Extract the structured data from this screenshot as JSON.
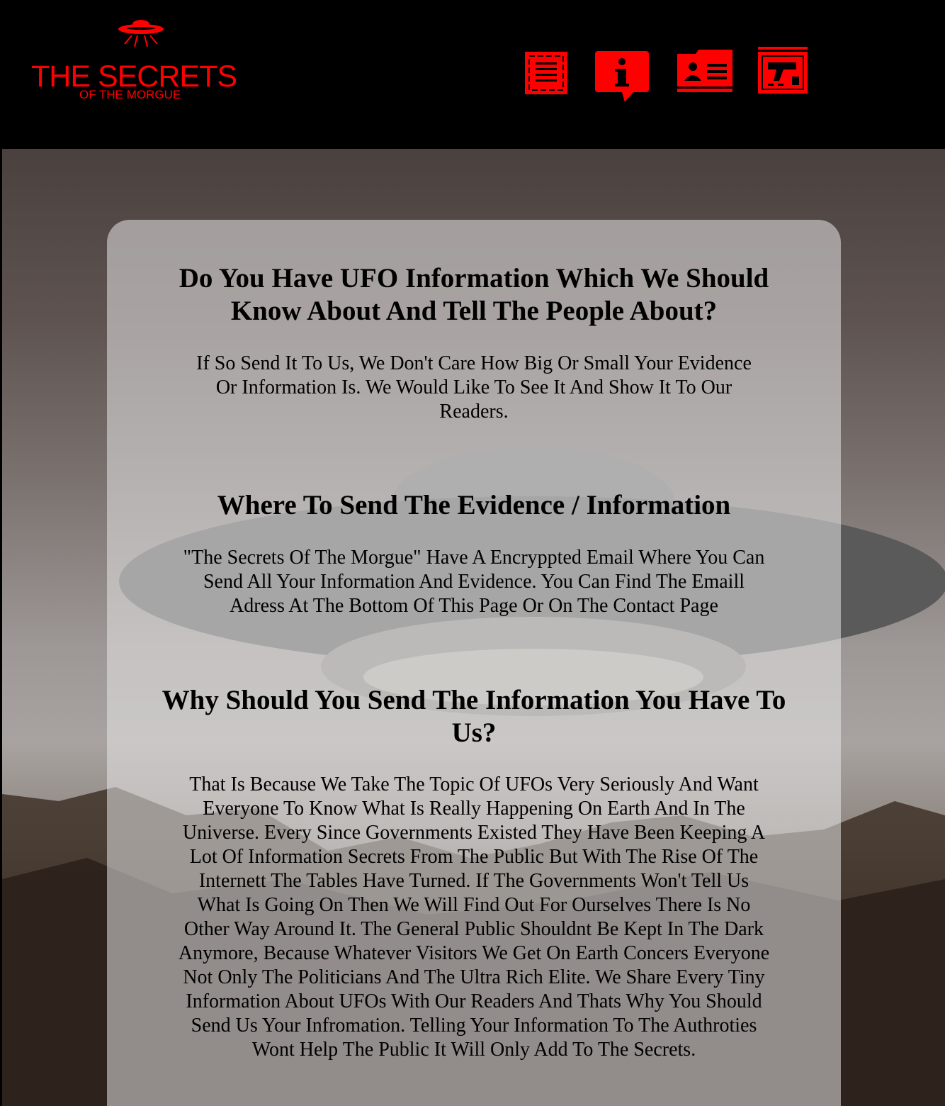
{
  "brand": {
    "title": "THE SECRETS",
    "subtitle": "OF THE MORGUE",
    "color": "#ff0000"
  },
  "nav": [
    {
      "icon": "document-list-icon",
      "label": "Articles"
    },
    {
      "icon": "info-bubble-icon",
      "label": "About"
    },
    {
      "icon": "contact-card-icon",
      "label": "Contact"
    },
    {
      "icon": "evidence-case-icon",
      "label": "Evidence"
    }
  ],
  "content": {
    "section1": {
      "heading": "Do You Have UFO Information Which We Should Know About And Tell The People About?",
      "text": "If So Send It To Us, We Don't Care How Big Or Small Your Evidence Or Information Is. We Would Like To See It And Show It To Our Readers."
    },
    "section2": {
      "heading": "Where To Send The Evidence / Information",
      "text": "\"The Secrets Of The Morgue\" Have A Encryppted Email Where You Can Send All Your Information And Evidence. You Can Find The Emaill Adress At The Bottom Of This Page Or On The Contact Page"
    },
    "section3": {
      "heading": "Why Should You Send The Information You Have To Us?",
      "text": "That Is Because We Take The Topic Of UFOs Very Seriously And Want Everyone To Know What Is Really Happening On Earth And In The Universe. Every Since Governments Existed They Have Been Keeping A Lot Of Information Secrets From The Public But With The Rise Of The Internett The Tables Have Turned. If The Governments Won't Tell Us What Is Going On Then We Will Find Out For Ourselves There Is No Other Way Around It. The General Public Shouldnt Be Kept In The Dark Anymore, Because Whatever Visitors We Get On Earth Concers Everyone Not Only The Politicians And The Ultra Rich Elite. We Share Every Tiny Information About UFOs With Our Readers And Thats Why You Should Send Us Your Infromation. Telling Your Information To The Authroties Wont Help The Public It Will Only Add To The Secrets."
    }
  }
}
